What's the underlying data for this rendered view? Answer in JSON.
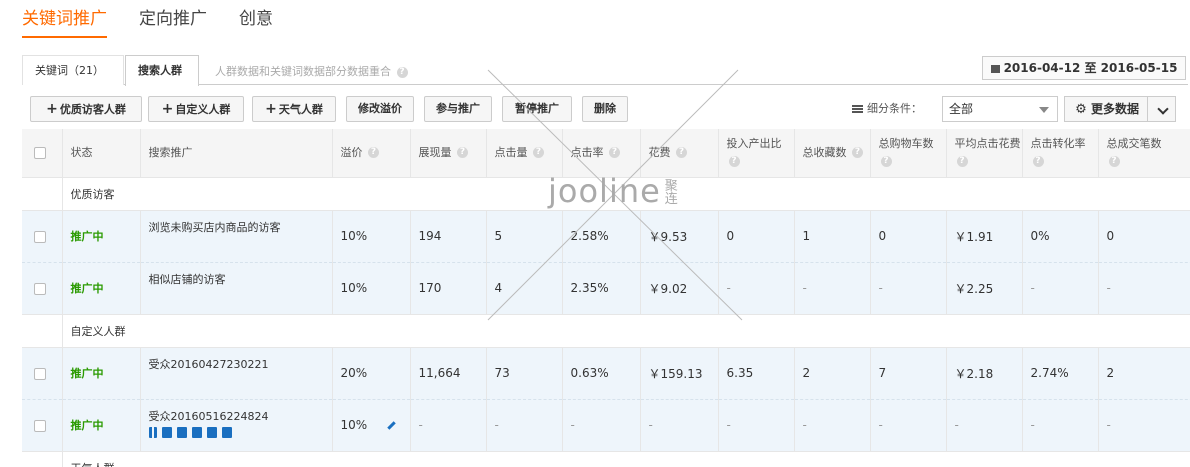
{
  "top_tabs": [
    "关键词推广",
    "定向推广",
    "创意"
  ],
  "sub_tabs": {
    "keywords": "关键词（21）",
    "audience": "搜索人群",
    "note": "人群数据和关键词数据部分数据重合"
  },
  "date_range": "2016-04-12 至 2016-05-15",
  "toolbar": {
    "buttons": [
      "优质访客人群",
      "自定义人群",
      "天气人群",
      "修改溢价",
      "参与推广",
      "暂停推广",
      "删除"
    ],
    "filter_label": "细分条件：",
    "filter_value": "全部",
    "more_data": "更多数据"
  },
  "columns": [
    "状态",
    "搜索推广",
    "溢价",
    "展现量",
    "点击量",
    "点击率",
    "花费",
    "投入产出比",
    "总收藏数",
    "总购物车数",
    "平均点击花费",
    "点击转化率",
    "总成交笔数"
  ],
  "groups": [
    {
      "title": "优质访客",
      "rows": [
        {
          "status": "推广中",
          "name": "浏览未购买店内商品的访客",
          "premium": "10%",
          "impressions": "194",
          "clicks": "5",
          "ctr": "2.58%",
          "cost": "￥9.53",
          "roi": "0",
          "favorites": "1",
          "cart": "0",
          "cpc": "￥1.91",
          "cvr": "0%",
          "orders": "0"
        },
        {
          "status": "推广中",
          "name": "相似店铺的访客",
          "premium": "10%",
          "impressions": "170",
          "clicks": "4",
          "ctr": "2.35%",
          "cost": "￥9.02",
          "roi": "-",
          "favorites": "-",
          "cart": "-",
          "cpc": "￥2.25",
          "cvr": "-",
          "orders": "-"
        }
      ]
    },
    {
      "title": "自定义人群",
      "rows": [
        {
          "status": "推广中",
          "name": "受众20160427230221",
          "premium": "20%",
          "impressions": "11,664",
          "clicks": "73",
          "ctr": "0.63%",
          "cost": "￥159.13",
          "roi": "6.35",
          "favorites": "2",
          "cart": "7",
          "cpc": "￥2.18",
          "cvr": "2.74%",
          "orders": "2"
        },
        {
          "status": "推广中",
          "name": "受众20160516224824",
          "premium": "10%",
          "impressions": "-",
          "clicks": "-",
          "ctr": "-",
          "cost": "-",
          "roi": "-",
          "favorites": "-",
          "cart": "-",
          "cpc": "-",
          "cvr": "-",
          "orders": "-"
        }
      ]
    },
    {
      "title": "天气人群",
      "rows": []
    }
  ],
  "watermark": {
    "brand": "jooline",
    "cn": "聚连"
  }
}
